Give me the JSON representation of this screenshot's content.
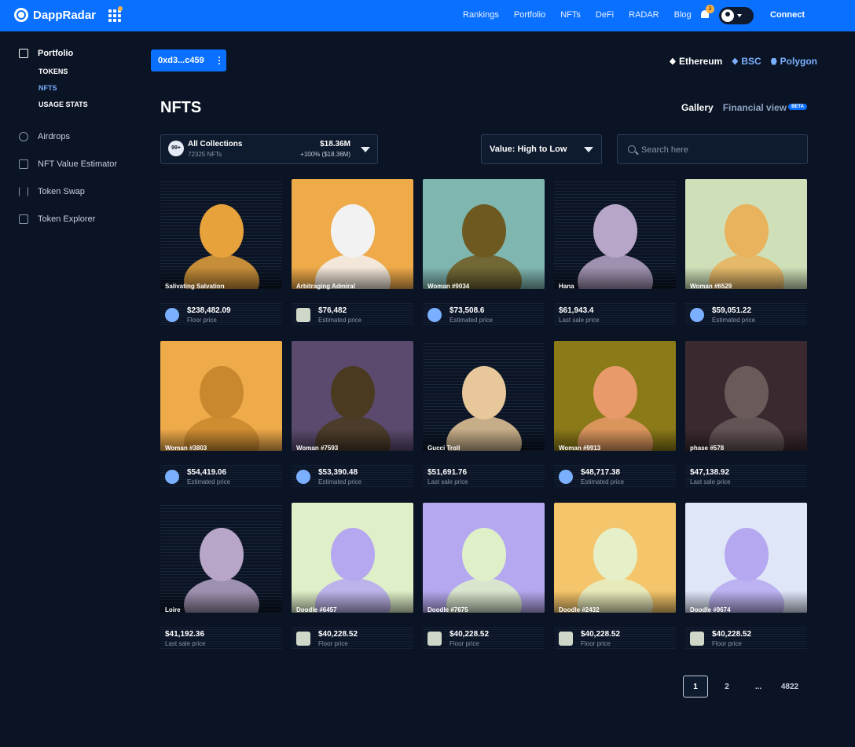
{
  "app": {
    "name": "DappRadar",
    "nav": [
      "Rankings",
      "Portfolio",
      "NFTs",
      "DeFi",
      "RADAR",
      "Blog"
    ],
    "notification_count": "3",
    "connect_label": "Connect"
  },
  "sidebar": {
    "portfolio_label": "Portfolio",
    "sub_items": [
      "TOKENS",
      "NFTS",
      "USAGE STATS"
    ],
    "items": [
      "Airdrops",
      "NFT Value Estimator",
      "Token Swap",
      "Token Explorer"
    ]
  },
  "wallet": {
    "address": "0xd3...c459"
  },
  "chains": [
    "Ethereum",
    "BSC",
    "Polygon"
  ],
  "page": {
    "title": "NFTS"
  },
  "views": {
    "gallery": "Gallery",
    "financial": "Financial view",
    "beta": "BETA"
  },
  "collection": {
    "badge": "99+",
    "name": "All Collections",
    "count": "72325 NFTs",
    "value": "$18.36M",
    "change": "+100% ($18.36M)"
  },
  "sort": {
    "label": "Value: High to Low"
  },
  "search": {
    "placeholder": "Search here"
  },
  "nfts": [
    {
      "name": "Salivating Salvation",
      "price": "$238,482.09",
      "label": "Floor price",
      "bg": "#0b1424",
      "accent": "#e8a23c"
    },
    {
      "name": "Arbitraging Admiral",
      "price": "$76,482",
      "label": "Estimated price",
      "bg": "#efaa4a",
      "accent": "#f2f2f2"
    },
    {
      "name": "Woman #9034",
      "price": "$73,508.6",
      "label": "Estimated price",
      "bg": "#7fb6b0",
      "accent": "#6e5a20"
    },
    {
      "name": "Hana",
      "price": "$61,943.4",
      "label": "Last sale price",
      "bg": "#0b1424",
      "accent": "#b8a6c8"
    },
    {
      "name": "Woman #6529",
      "price": "$59,051.22",
      "label": "Estimated price",
      "bg": "#cfe0b8",
      "accent": "#e9b25c"
    },
    {
      "name": "Woman #3803",
      "price": "$54,419.06",
      "label": "Estimated price",
      "bg": "#efaa4a",
      "accent": "#c9882e"
    },
    {
      "name": "Woman #7593",
      "price": "$53,390.48",
      "label": "Estimated price",
      "bg": "#5b4a6e",
      "accent": "#4a3a20"
    },
    {
      "name": "Gucci Troll",
      "price": "$51,691.76",
      "label": "Last sale price",
      "bg": "#0b1424",
      "accent": "#e8c89a"
    },
    {
      "name": "Woman #9913",
      "price": "$48,717.38",
      "label": "Estimated price",
      "bg": "#8a7a18",
      "accent": "#e89a6a"
    },
    {
      "name": "phase #578",
      "price": "$47,138.92",
      "label": "Last sale price",
      "bg": "#3a2a30",
      "accent": "#6a5a5a"
    },
    {
      "name": "Loire",
      "price": "$41,192.36",
      "label": "Last sale price",
      "bg": "#0b1424",
      "accent": "#b8a6c8"
    },
    {
      "name": "Doodle #6457",
      "price": "$40,228.52",
      "label": "Floor price",
      "bg": "#dff0c8",
      "accent": "#b6a8f0"
    },
    {
      "name": "Doodle #7675",
      "price": "$40,228.52",
      "label": "Floor price",
      "bg": "#b6a8f0",
      "accent": "#dff0c8"
    },
    {
      "name": "Doodle #2432",
      "price": "$40,228.52",
      "label": "Floor price",
      "bg": "#f4c56a",
      "accent": "#e6f0c8"
    },
    {
      "name": "Doodle #9674",
      "price": "$40,228.52",
      "label": "Floor price",
      "bg": "#dfe6f8",
      "accent": "#b6a8f0"
    }
  ],
  "pagination": [
    "1",
    "2",
    "...",
    "4822"
  ]
}
